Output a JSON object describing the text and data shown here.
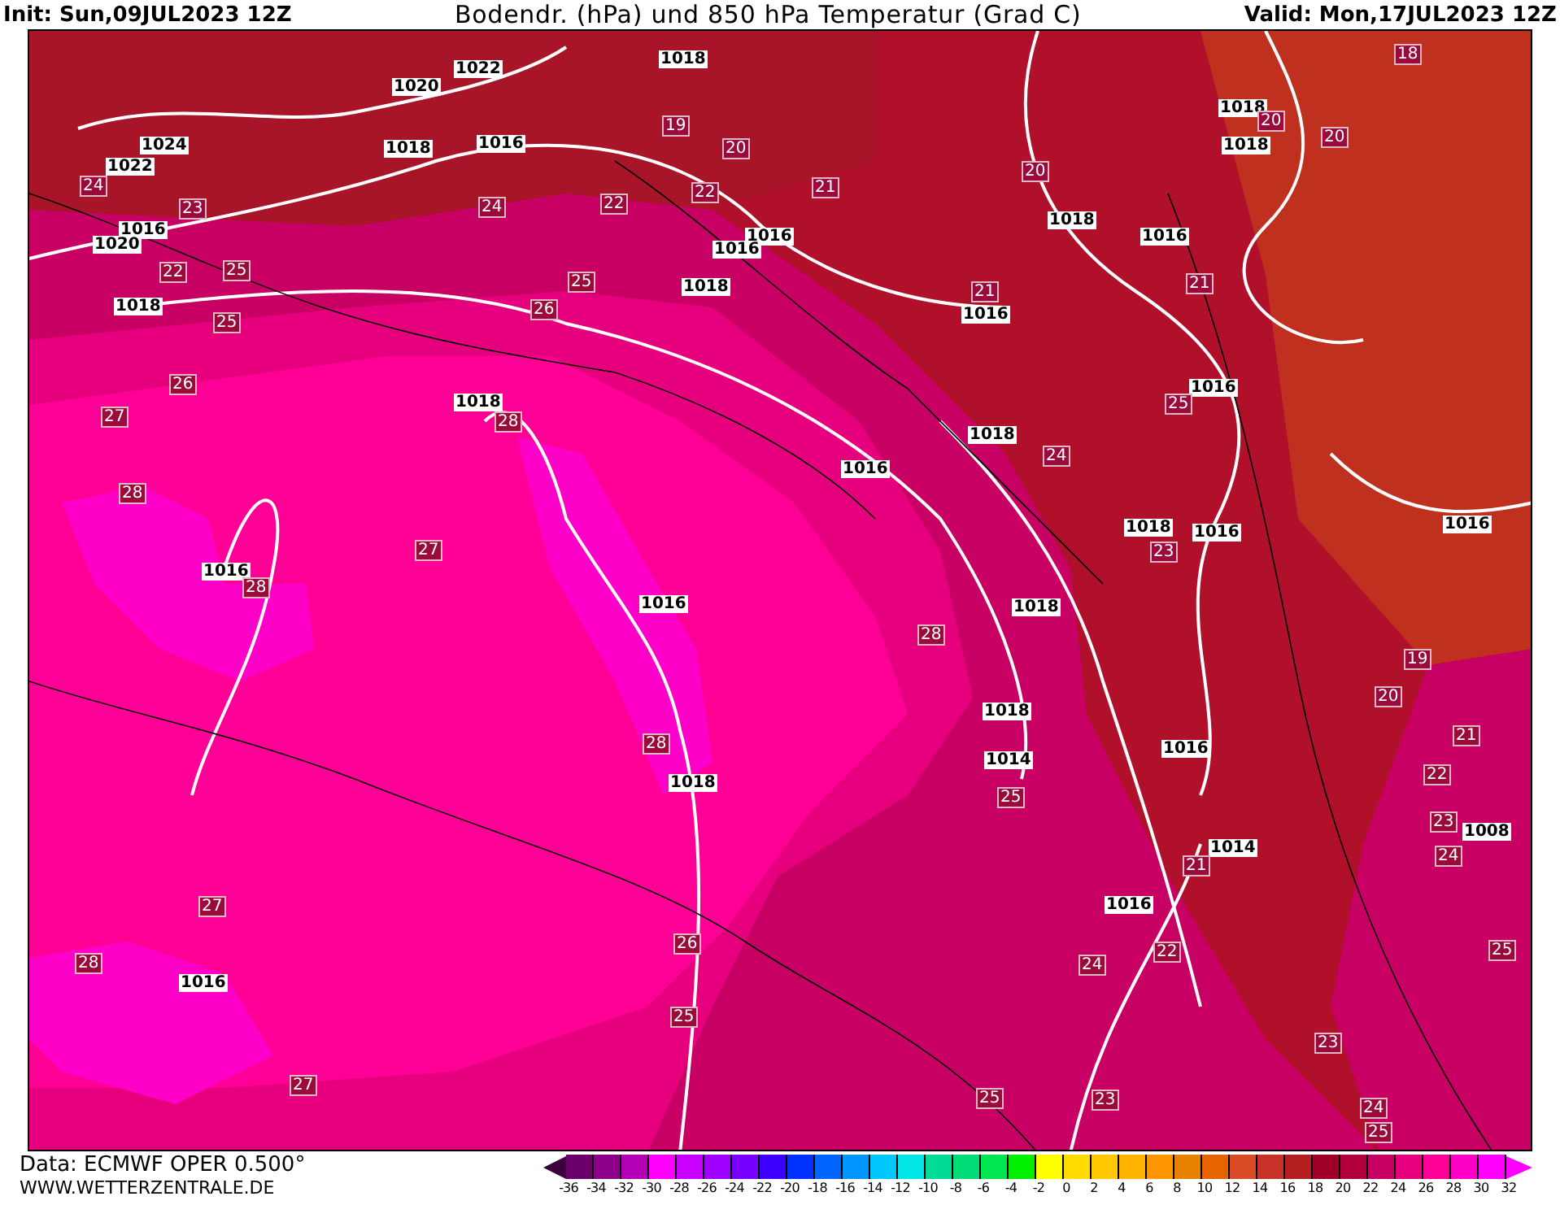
{
  "header": {
    "init": "Init: Sun,09JUL2023 12Z",
    "title": "Bodendr. (hPa) und 850 hPa Temperatur (Grad C)",
    "valid": "Valid: Mon,17JUL2023 12Z"
  },
  "map": {
    "pressure_labels": [
      "1018",
      "1022",
      "1020",
      "1024",
      "1022",
      "1018",
      "1016",
      "1018",
      "1018",
      "1018",
      "1016",
      "1016",
      "1016",
      "1018",
      "1018",
      "1016",
      "1020",
      "1016",
      "1018",
      "1018",
      "1016",
      "1016",
      "1018",
      "1016",
      "1016",
      "1016",
      "1016",
      "1018",
      "1018",
      "1016",
      "1014",
      "1018",
      "1014",
      "1008",
      "1016",
      "1016"
    ],
    "temperature_labels": [
      "19",
      "20",
      "20",
      "20",
      "20",
      "22",
      "22",
      "21",
      "24",
      "24",
      "23",
      "22",
      "25",
      "25",
      "26",
      "25",
      "21",
      "21",
      "26",
      "27",
      "28",
      "28",
      "24",
      "25",
      "23",
      "27",
      "28",
      "28",
      "28",
      "19",
      "20",
      "21",
      "25",
      "22",
      "23",
      "24",
      "21",
      "27",
      "26",
      "28",
      "22",
      "25",
      "24",
      "25",
      "23",
      "27",
      "25",
      "23",
      "24",
      "25",
      "18"
    ]
  },
  "footer": {
    "data": "Data: ECMWF OPER 0.500°",
    "site": "WWW.WETTERZENTRALE.DE"
  },
  "legend": {
    "segments": [
      {
        "color": "#6b006b"
      },
      {
        "color": "#8c008c"
      },
      {
        "color": "#b400b4"
      },
      {
        "color": "#ff00ff"
      },
      {
        "color": "#c800ff"
      },
      {
        "color": "#a000ff"
      },
      {
        "color": "#7800ff"
      },
      {
        "color": "#3c00ff"
      },
      {
        "color": "#0032ff"
      },
      {
        "color": "#0064ff"
      },
      {
        "color": "#0096ff"
      },
      {
        "color": "#00c8ff"
      },
      {
        "color": "#00e6e6"
      },
      {
        "color": "#00dc96"
      },
      {
        "color": "#00dc78"
      },
      {
        "color": "#00e650"
      },
      {
        "color": "#00f000"
      },
      {
        "color": "#ffff00"
      },
      {
        "color": "#ffdc00"
      },
      {
        "color": "#ffc800"
      },
      {
        "color": "#ffb400"
      },
      {
        "color": "#ff9600"
      },
      {
        "color": "#e68200"
      },
      {
        "color": "#e66400"
      },
      {
        "color": "#dc4b28"
      },
      {
        "color": "#c83228"
      },
      {
        "color": "#b41e1e"
      },
      {
        "color": "#a00028"
      },
      {
        "color": "#b4003c"
      },
      {
        "color": "#c80064"
      },
      {
        "color": "#e6007d"
      },
      {
        "color": "#ff0096"
      },
      {
        "color": "#ff00c8"
      },
      {
        "color": "#ff00ff"
      }
    ],
    "ticks": [
      "-36",
      "-34",
      "-32",
      "-30",
      "-28",
      "-26",
      "-24",
      "-22",
      "-20",
      "-18",
      "-16",
      "-14",
      "-12",
      "-10",
      "-8",
      "-6",
      "-4",
      "-2",
      "0",
      "2",
      "4",
      "6",
      "8",
      "10",
      "12",
      "14",
      "16",
      "18",
      "20",
      "22",
      "24",
      "26",
      "28",
      "30",
      "32"
    ]
  }
}
